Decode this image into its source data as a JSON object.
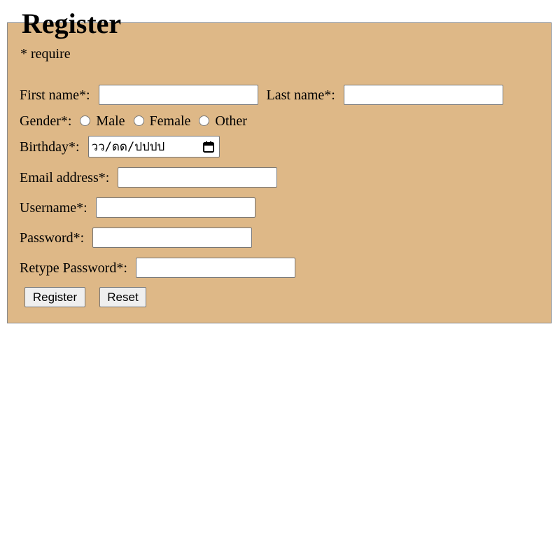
{
  "form": {
    "title": "Register",
    "require_note": "* require",
    "first_name": {
      "label": "First name*:",
      "value": ""
    },
    "last_name": {
      "label": "Last name*:",
      "value": ""
    },
    "gender": {
      "label": "Gender*:",
      "options": [
        "Male",
        "Female",
        "Other"
      ],
      "selected": null
    },
    "birthday": {
      "label": "Birthday*:",
      "placeholder": "วว/ดด/ปปปป",
      "icon": "calendar-icon"
    },
    "email": {
      "label": "Email address*:",
      "value": ""
    },
    "username": {
      "label": "Username*:",
      "value": ""
    },
    "password": {
      "label": "Password*:",
      "value": ""
    },
    "retype_password": {
      "label": "Retype Password*:",
      "value": ""
    },
    "buttons": {
      "register": "Register",
      "reset": "Reset"
    },
    "colors": {
      "background": "#deb887",
      "border": "#8a8a8a"
    }
  }
}
